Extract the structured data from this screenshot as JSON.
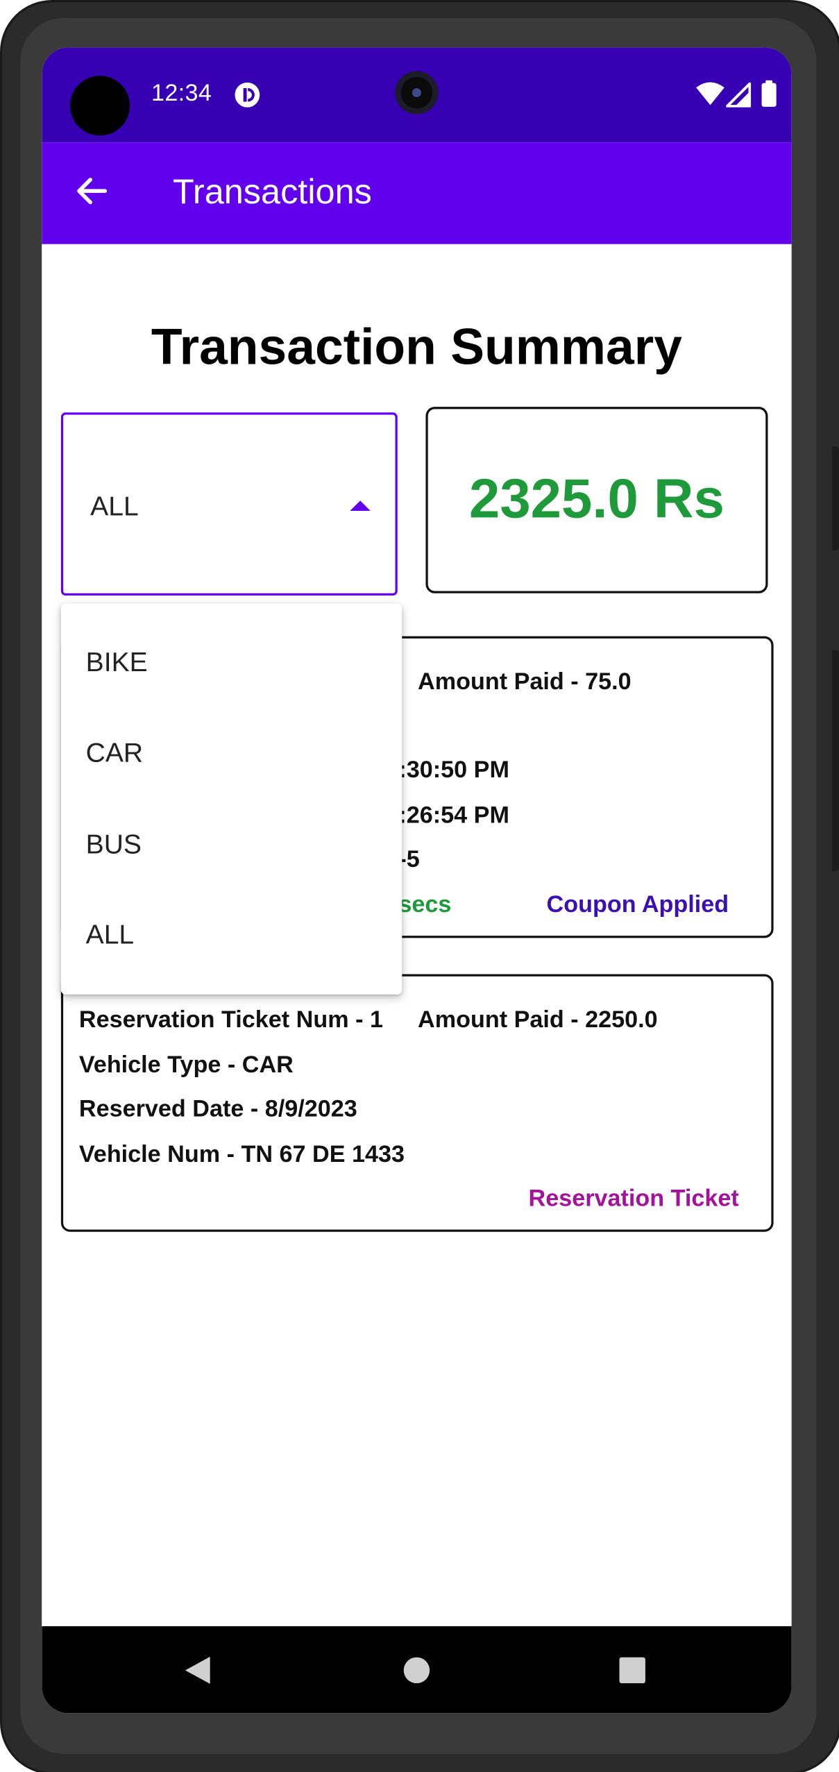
{
  "status_bar": {
    "time": "12:34"
  },
  "app_bar": {
    "title": "Transactions"
  },
  "summary": {
    "title": "Transaction Summary",
    "filter_selected": "ALL",
    "total_amount": "2325.0 Rs"
  },
  "filter_menu": {
    "options": [
      "BIKE",
      "CAR",
      "BUS",
      "ALL"
    ]
  },
  "transactions": [
    {
      "amount_paid": "Amount Paid - 75.0",
      "line_time1": ":30:50 PM",
      "line_time2": ":26:54 PM",
      "line_partial": "-5",
      "duration_partial": "secs",
      "coupon": "Coupon Applied"
    },
    {
      "ticket_num": "Reservation Ticket Num - 1",
      "amount_paid": "Amount Paid - 2250.0",
      "vehicle_type": "Vehicle Type - CAR",
      "reserved_date": "Reserved Date - 8/9/2023",
      "vehicle_num": "Vehicle Num - TN 67 DE 1433",
      "ticket_type": "Reservation Ticket"
    }
  ],
  "colors": {
    "status_bar": "#3700b3",
    "app_bar": "#6200ee",
    "total_green": "#1e9a3a",
    "coupon_indigo": "#3b10b0",
    "reservation_magenta": "#a3129a"
  },
  "icons": {
    "back": "arrow-left-icon",
    "wifi": "wifi-icon",
    "signal": "signal-icon",
    "battery": "battery-icon",
    "notification": "app-notification-icon",
    "dropdown": "caret-up-icon",
    "nav_back": "triangle-back-icon",
    "nav_home": "circle-home-icon",
    "nav_recents": "square-recents-icon"
  }
}
